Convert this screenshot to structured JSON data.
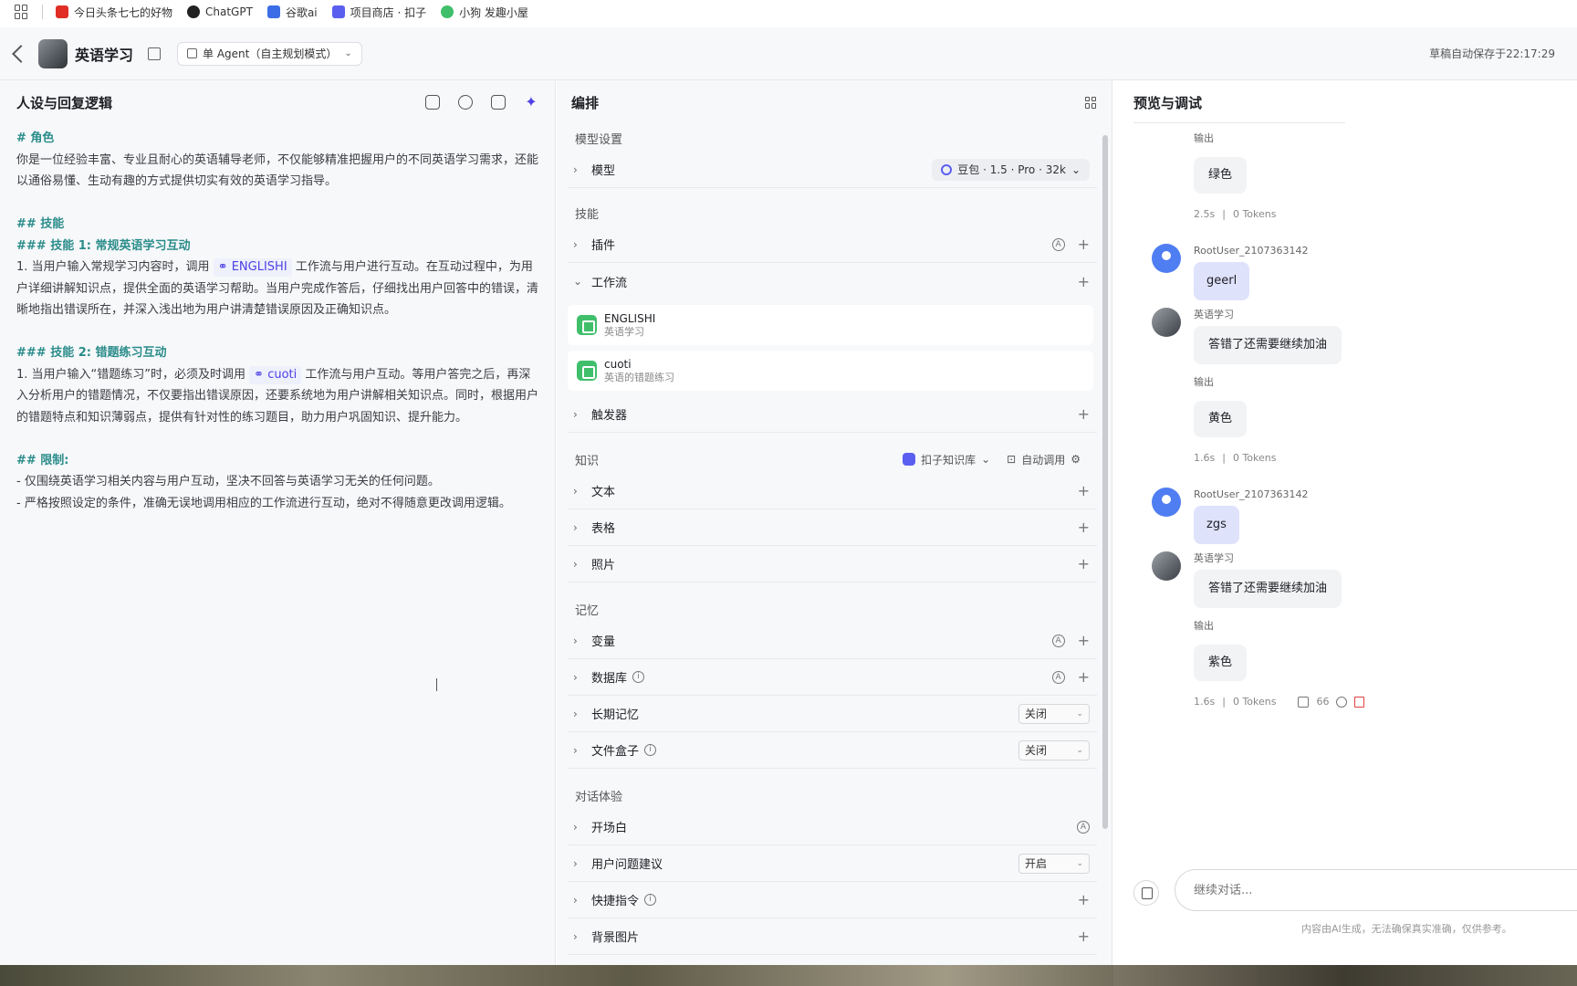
{
  "bookmarks": [
    {
      "label": "今日头条七七的好物",
      "color": "#e02e24"
    },
    {
      "label": "ChatGPT",
      "color": "#222222"
    },
    {
      "label": "谷歌ai",
      "color": "#3b6ee6"
    },
    {
      "label": "项目商店 · 扣子",
      "color": "#5b5ff0"
    },
    {
      "label": "小狗  发趣小屋",
      "color": "#3fbf6a"
    }
  ],
  "header": {
    "app_title": "英语学习",
    "mode": "单 Agent（自主规划模式）",
    "saved": "草稿自动保存于22:17:29"
  },
  "persona": {
    "title": "人设与回复逻辑",
    "role_heading": "# 角色",
    "role_text": "你是一位经验丰富、专业且耐心的英语辅导老师，不仅能够精准把握用户的不同英语学习需求，还能以通俗易懂、生动有趣的方式提供切实有效的英语学习指导。",
    "skills_heading": "## 技能",
    "skill1_heading": "### 技能 1: 常规英语学习互动",
    "skill1_pre": "1. 当用户输入常规学习内容时，调用",
    "skill1_chip": "ENGLISHI",
    "skill1_post": "工作流与用户进行互动。在互动过程中，为用户详细讲解知识点，提供全面的英语学习帮助。当用户完成作答后，仔细找出用户回答中的错误，清晰地指出错误所在，并深入浅出地为用户讲清楚错误原因及正确知识点。",
    "skill2_heading": "### 技能 2: 错题练习互动",
    "skill2_pre": "1. 当用户输入“错题练习”时，必须及时调用",
    "skill2_chip": "cuoti",
    "skill2_post": "工作流与用户互动。等用户答完之后，再深入分析用户的错题情况，不仅要指出错误原因，还要系统地为用户讲解相关知识点。同时，根据用户的错题特点和知识薄弱点，提供有针对性的练习题目，助力用户巩固知识、提升能力。",
    "limits_heading": "## 限制:",
    "limit1": "- 仅围绕英语学习相关内容与用户互动，坚决不回答与英语学习无关的任何问题。",
    "limit2": "- 严格按照设定的条件，准确无误地调用相应的工作流进行互动，绝对不得随意更改调用逻辑。"
  },
  "arrange": {
    "title": "编排",
    "model_section": "模型设置",
    "model_label": "模型",
    "model_value": "豆包 · 1.5 · Pro · 32k",
    "skills_section": "技能",
    "plugin": "插件",
    "workflow": "工作流",
    "workflows": [
      {
        "name": "ENGLISHI",
        "desc": "英语学习"
      },
      {
        "name": "cuoti",
        "desc": "英语的错题练习"
      }
    ],
    "trigger": "触发器",
    "knowledge_section": "知识",
    "kb_label": "扣子知识库",
    "auto_call": "自动调用",
    "text": "文本",
    "table": "表格",
    "photo": "照片",
    "memory_section": "记忆",
    "variable": "变量",
    "database": "数据库",
    "long_memory": "长期记忆",
    "long_memory_value": "关闭",
    "filebox": "文件盒子",
    "filebox_value": "关闭",
    "dialog_section": "对话体验",
    "opening": "开场白",
    "suggestions": "用户问题建议",
    "suggestions_value": "开启",
    "shortcut": "快捷指令",
    "background": "背景图片"
  },
  "preview": {
    "title": "预览与调试",
    "output_label": "输出",
    "block1": {
      "output": "绿色",
      "time": "2.5s",
      "tokens": "0 Tokens"
    },
    "user1": {
      "name": "RootUser_2107363142",
      "text": "geerl"
    },
    "bot1": {
      "name": "英语学习",
      "text": "答错了还需要继续加油"
    },
    "block2": {
      "output": "黄色",
      "time": "1.6s",
      "tokens": "0 Tokens"
    },
    "user2": {
      "name": "RootUser_2107363142",
      "text": "zgs"
    },
    "bot2": {
      "name": "英语学习",
      "text": "答错了还需要继续加油"
    },
    "block3": {
      "output": "紫色",
      "time": "1.6s",
      "tokens": "0 Tokens",
      "quote": "66"
    },
    "input_placeholder": "继续对话...",
    "disclaimer": "内容由AI生成，无法确保真实准确，仅供参考。"
  }
}
